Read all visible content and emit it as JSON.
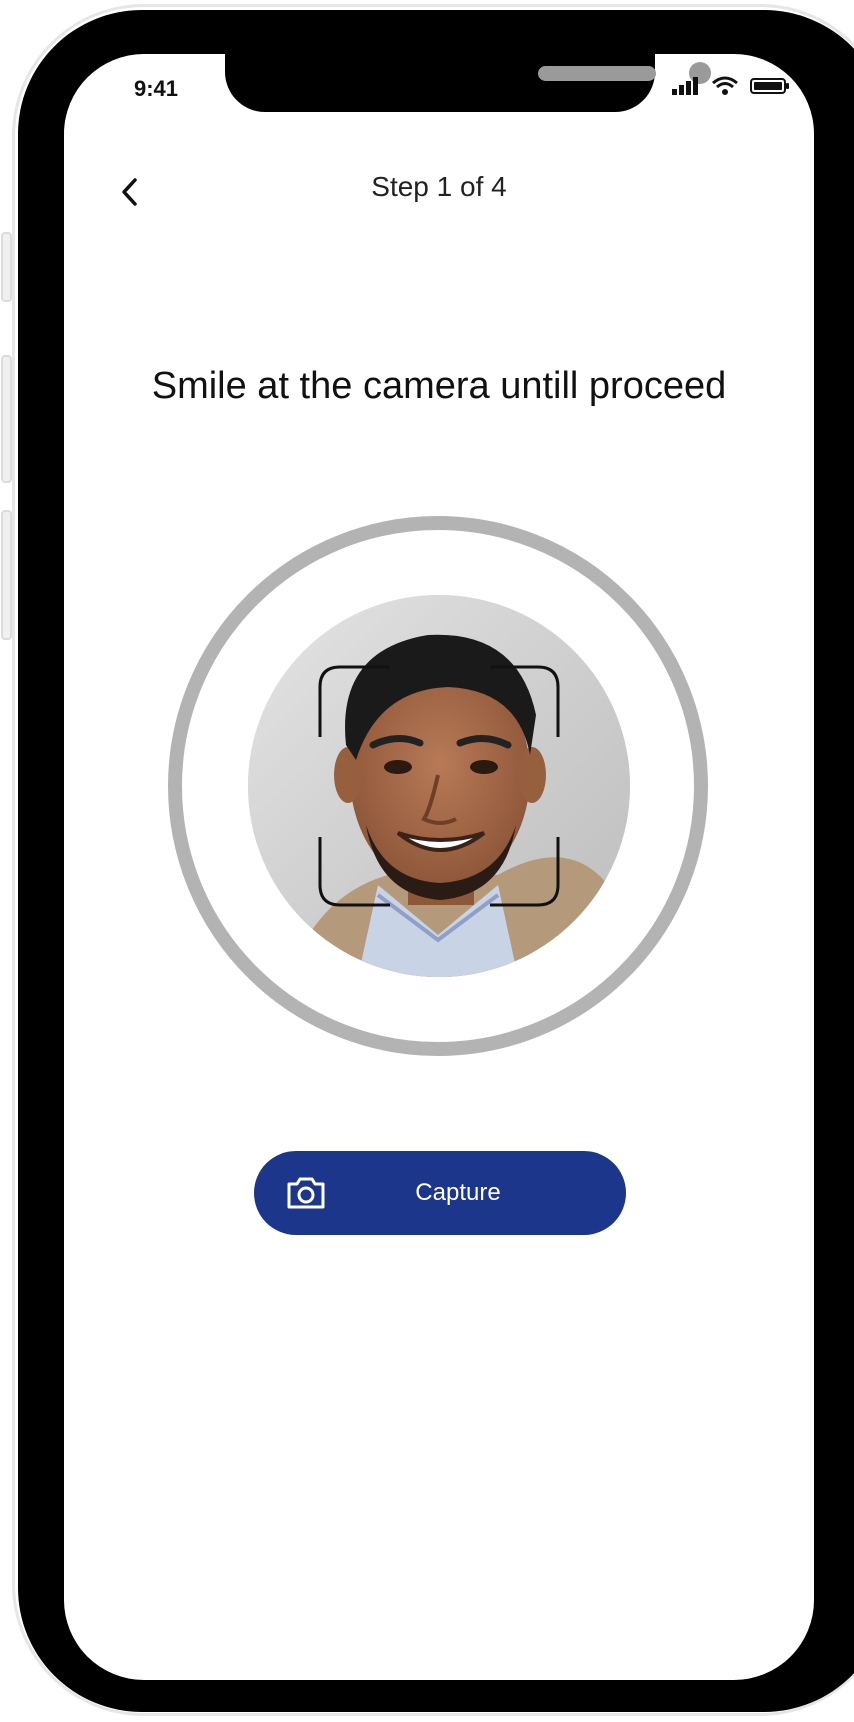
{
  "status_bar": {
    "time": "9:41",
    "icons": [
      "signal-icon",
      "wifi-icon",
      "battery-icon"
    ]
  },
  "header": {
    "back_icon": "chevron-left-icon",
    "step_label": "Step 1 of 4"
  },
  "main": {
    "instruction": "Smile at the camera untill proceed",
    "photo_description_icon": "face-scan-frame-icon"
  },
  "actions": {
    "capture_label": "Capture",
    "capture_icon": "camera-icon"
  },
  "colors": {
    "accent": "#1c368b",
    "ring": "#b3b3b3",
    "background": "#ffffff"
  }
}
